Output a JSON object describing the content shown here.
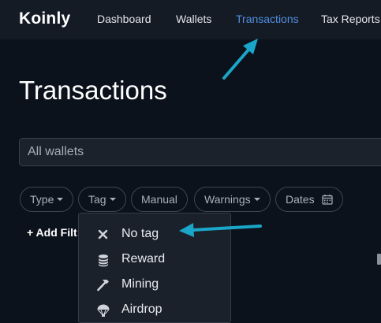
{
  "app": {
    "logo": "Koinly"
  },
  "nav": {
    "items": [
      {
        "label": "Dashboard"
      },
      {
        "label": "Wallets"
      },
      {
        "label": "Transactions",
        "active": true
      },
      {
        "label": "Tax Reports"
      }
    ]
  },
  "page": {
    "title": "Transactions"
  },
  "wallet_filter": {
    "placeholder": "All wallets",
    "value": ""
  },
  "filters": {
    "type": "Type",
    "tag": "Tag",
    "manual": "Manual",
    "warnings": "Warnings",
    "dates": "Dates",
    "add_filter": "+ Add Filt"
  },
  "tag_menu": {
    "items": [
      {
        "label": "No tag",
        "icon": "close-icon"
      },
      {
        "label": "Reward",
        "icon": "coins-icon"
      },
      {
        "label": "Mining",
        "icon": "hammer-icon"
      },
      {
        "label": "Airdrop",
        "icon": "parachute-icon"
      }
    ]
  },
  "colors": {
    "background": "#0c121b",
    "navbar": "#151b24",
    "active_nav": "#4f8fe0",
    "annotation_arrow": "#1aa6c8"
  }
}
